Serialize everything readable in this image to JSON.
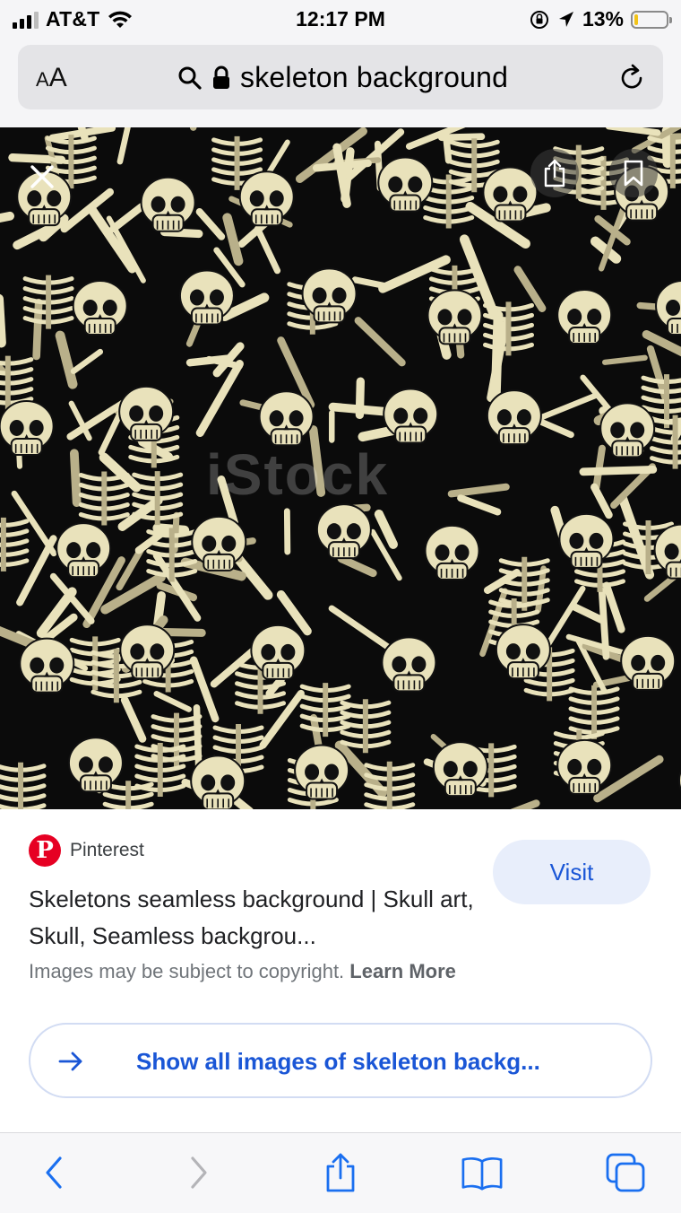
{
  "status_bar": {
    "carrier": "AT&T",
    "time": "12:17 PM",
    "battery_percent": "13%",
    "battery_level": 0.13,
    "signal_bars_filled": 3,
    "signal_bars_total": 4,
    "icons": [
      "wifi-icon",
      "orientation-lock-icon",
      "location-arrow-icon",
      "battery-icon"
    ]
  },
  "address_bar": {
    "aa_label_small": "A",
    "aa_label_large": "A",
    "query": "skeleton background",
    "icons": [
      "search-icon",
      "lock-icon",
      "reload-icon"
    ]
  },
  "image_viewer": {
    "watermark": "iStock",
    "icons": [
      "close-icon",
      "share-icon",
      "bookmark-icon"
    ]
  },
  "result": {
    "source": "Pinterest",
    "source_logo_letter": "P",
    "title": "Skeletons seamless background | Skull art, Skull, Seamless backgrou...",
    "visit_label": "Visit",
    "copyright_text": "Images may be subject to copyright.",
    "learn_more": "Learn More",
    "show_all_label": "Show all images of skeleton backg...",
    "accent_color": "#1a56d6",
    "visit_bg_color": "#e8eefb",
    "brand_color": "#e60023"
  },
  "toolbar": {
    "icons": [
      "back-icon",
      "forward-icon",
      "share-icon",
      "bookmarks-icon",
      "tabs-icon"
    ]
  }
}
